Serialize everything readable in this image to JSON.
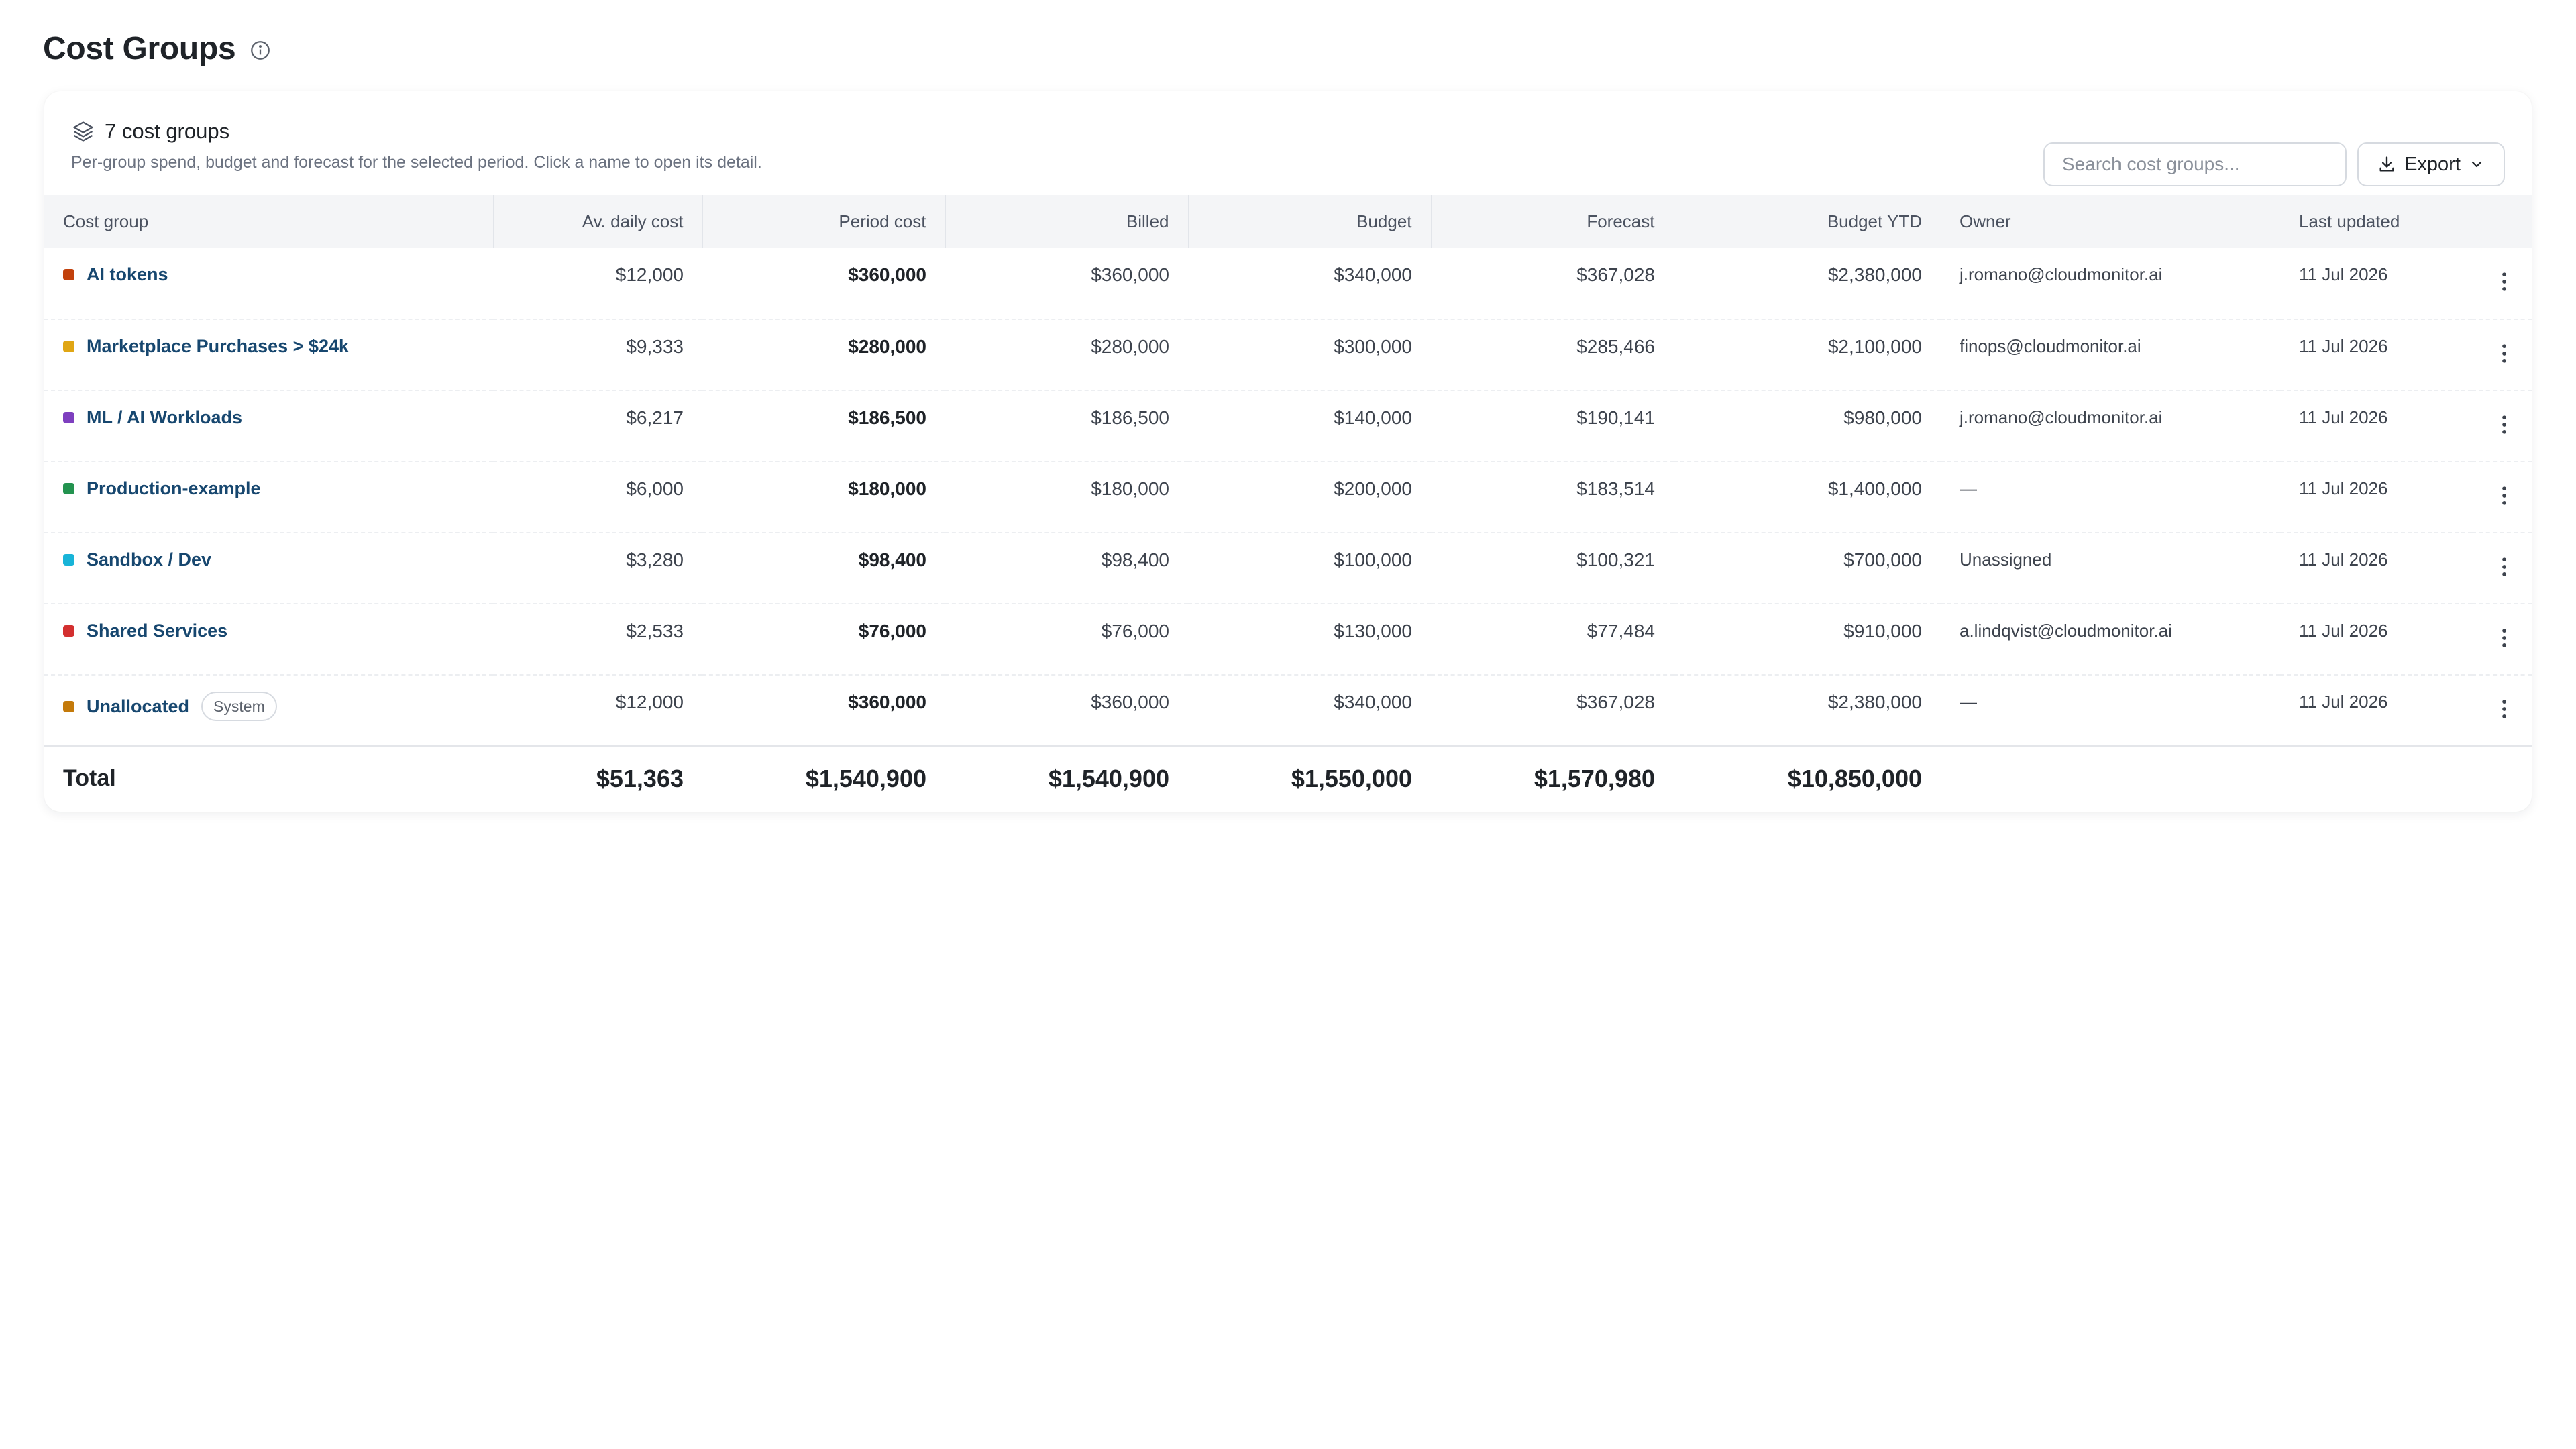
{
  "page": {
    "title": "Cost Groups"
  },
  "card": {
    "count_label": "7 cost groups",
    "description": "Per-group spend, budget and forecast for the selected period. Click a name to open its detail.",
    "search_placeholder": "Search cost groups...",
    "export_label": "Export"
  },
  "columns": [
    "Cost group",
    "Av. daily cost",
    "Period cost",
    "Billed",
    "Budget",
    "Forecast",
    "Budget YTD",
    "Owner",
    "Last updated"
  ],
  "rows": [
    {
      "name": "AI tokens",
      "color": "#c2410c",
      "daily": "$12,000",
      "period": "$360,000",
      "billed": "$360,000",
      "budget": "$340,000",
      "forecast": "$367,028",
      "budget_ytd": "$2,380,000",
      "owner": "j.romano@cloudmonitor.ai",
      "updated": "11 Jul 2026"
    },
    {
      "name": "Marketplace Purchases > $24k",
      "color": "#e0a614",
      "daily": "$9,333",
      "period": "$280,000",
      "billed": "$280,000",
      "budget": "$300,000",
      "forecast": "$285,466",
      "budget_ytd": "$2,100,000",
      "owner": "finops@cloudmonitor.ai",
      "updated": "11 Jul 2026"
    },
    {
      "name": "ML / AI Workloads",
      "color": "#7e3fbf",
      "daily": "$6,217",
      "period": "$186,500",
      "billed": "$186,500",
      "budget": "$140,000",
      "forecast": "$190,141",
      "budget_ytd": "$980,000",
      "owner": "j.romano@cloudmonitor.ai",
      "updated": "11 Jul 2026"
    },
    {
      "name": "Production-example",
      "color": "#23934f",
      "daily": "$6,000",
      "period": "$180,000",
      "billed": "$180,000",
      "budget": "$200,000",
      "forecast": "$183,514",
      "budget_ytd": "$1,400,000",
      "owner": "—",
      "updated": "11 Jul 2026"
    },
    {
      "name": "Sandbox / Dev",
      "color": "#18b4d8",
      "daily": "$3,280",
      "period": "$98,400",
      "billed": "$98,400",
      "budget": "$100,000",
      "forecast": "$100,321",
      "budget_ytd": "$700,000",
      "owner": "Unassigned",
      "updated": "11 Jul 2026"
    },
    {
      "name": "Shared Services",
      "color": "#d32f2f",
      "daily": "$2,533",
      "period": "$76,000",
      "billed": "$76,000",
      "budget": "$130,000",
      "forecast": "$77,484",
      "budget_ytd": "$910,000",
      "owner": "a.lindqvist@cloudmonitor.ai",
      "updated": "11 Jul 2026"
    },
    {
      "name": "Unallocated",
      "badge": "System",
      "color": "#c47a0a",
      "daily": "$12,000",
      "period": "$360,000",
      "billed": "$360,000",
      "budget": "$340,000",
      "forecast": "$367,028",
      "budget_ytd": "$2,380,000",
      "owner": "—",
      "updated": "11 Jul 2026"
    }
  ],
  "total": {
    "label": "Total",
    "daily": "$51,363",
    "period": "$1,540,900",
    "billed": "$1,540,900",
    "budget": "$1,550,000",
    "forecast": "$1,570,980",
    "budget_ytd": "$10,850,000"
  }
}
